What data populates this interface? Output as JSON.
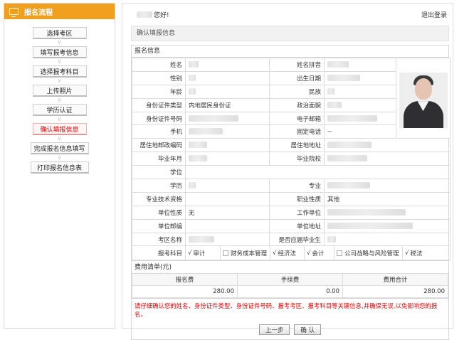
{
  "sidebar": {
    "title": "报名流程",
    "steps": [
      {
        "label": "选择考区",
        "active": false
      },
      {
        "label": "填写报考信息",
        "active": false
      },
      {
        "label": "选择报考科目",
        "active": false
      },
      {
        "label": "上传照片",
        "active": false
      },
      {
        "label": "学历认证",
        "active": false
      },
      {
        "label": "确认填报信息",
        "active": true
      },
      {
        "label": "完成报名信息填写",
        "active": false
      },
      {
        "label": "打印报名信息表",
        "active": false
      }
    ]
  },
  "header": {
    "greeting_suffix": "您好!",
    "logout": "退出登录"
  },
  "section_title": "确认填报信息",
  "form": {
    "title": "报名信息",
    "labels": {
      "name": "姓名",
      "name_pinyin": "姓名拼音",
      "gender": "性别",
      "birth_date": "出生日期",
      "age": "年龄",
      "ethnicity": "民族",
      "id_type": "身份证件类型",
      "political_status": "政治面貌",
      "id_number": "身份证件号码",
      "email": "电子邮箱",
      "mobile": "手机",
      "landline": "固定电话",
      "postal_code": "居住地邮政编码",
      "address": "居住地地址",
      "grad_date": "毕业年月",
      "school": "毕业院校",
      "degree": "学位",
      "education": "学历",
      "major": "专业",
      "tech_qualification": "专业技术资格",
      "occupation_type": "职业性质",
      "unit_type": "单位性质",
      "employer": "工作单位",
      "unit_postcode": "单位邮编",
      "unit_address": "单位地址",
      "exam_area": "考区名称",
      "fresh_grad": "是否应届毕业生",
      "subjects": "报考科目"
    },
    "values": {
      "id_type": "内地居民身份证",
      "landline": "--",
      "occupation_type": "其他",
      "unit_type": "无"
    },
    "subjects": [
      {
        "label": "审计",
        "checked": true
      },
      {
        "label": "财务成本管理",
        "checked": false
      },
      {
        "label": "经济法",
        "checked": true
      },
      {
        "label": "会计",
        "checked": true
      },
      {
        "label": "公司战略与风险管理",
        "checked": false
      },
      {
        "label": "税法",
        "checked": true
      }
    ]
  },
  "fees": {
    "title": "费用清单(元)",
    "headers": [
      "报名费",
      "手续费",
      "费用合计"
    ],
    "values": [
      "280.00",
      "0.00",
      "280.00"
    ]
  },
  "notice": "请仔细确认您的姓名、身份证件类型、身份证件号码、报考考区、报考科目等关键信息,并确保无误,以免影响您的报名。",
  "buttons": {
    "prev": "上一步",
    "confirm": "确 认"
  },
  "colors": {
    "accent": "#f0a01e",
    "active_step": "#e60000",
    "notice": "#e60000"
  }
}
